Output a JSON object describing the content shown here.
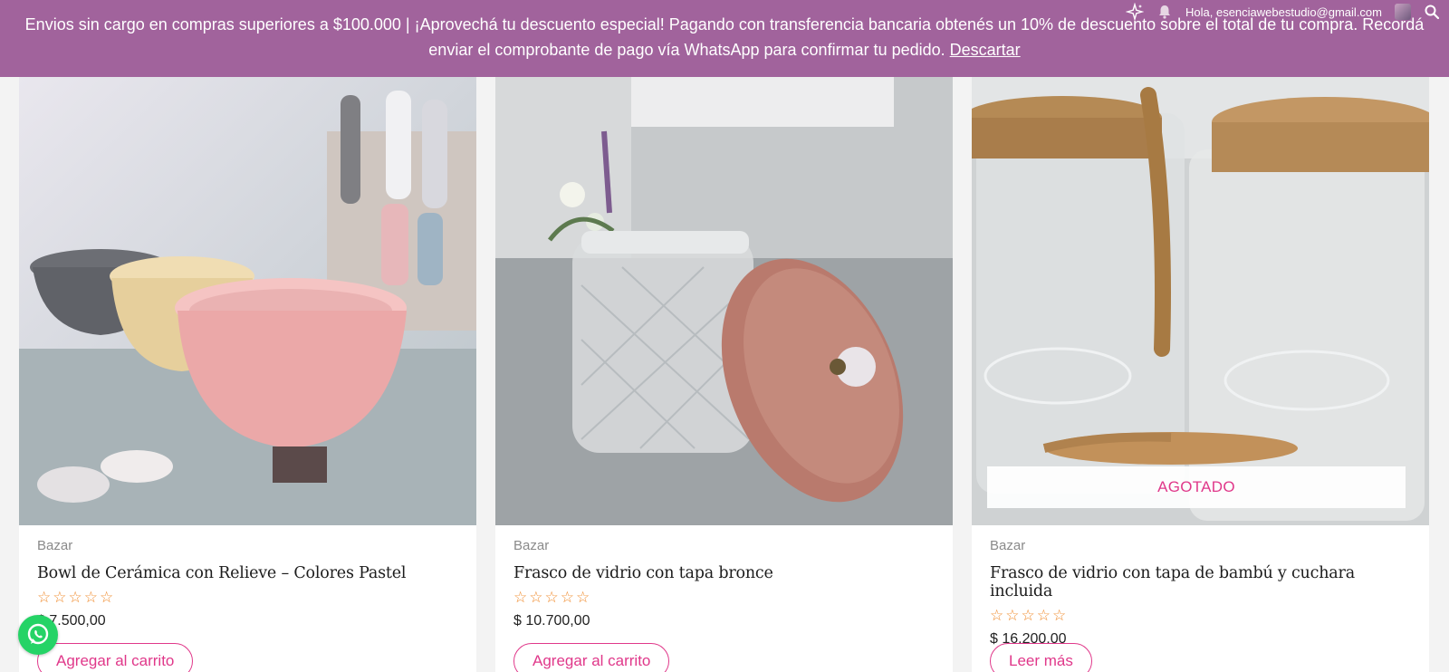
{
  "notice": {
    "text": "Envios sin cargo en compras superiores a $100.000 | ¡Aprovechá tu descuento especial! Pagando con transferencia bancaria obtenés un 10% de descuento sobre el total de tu compra. Recordá enviar el comprobante de pago vía WhatsApp para confirmar tu pedido.",
    "dismiss": "Descartar"
  },
  "admin": {
    "greeting": "Hola, esenciawebestudio@gmail.com",
    "icons": [
      "sparkle-icon",
      "bell-icon",
      "avatar",
      "search-icon"
    ]
  },
  "products": [
    {
      "category": "Bazar",
      "title": "Bowl de Cerámica con Relieve – Colores Pastel",
      "price": "$ 7.500,00",
      "rating": 0,
      "button": "Agregar al carrito",
      "badge": ""
    },
    {
      "category": "Bazar",
      "title": "Frasco de vidrio con tapa bronce",
      "price": "$ 10.700,00",
      "rating": 0,
      "button": "Agregar al carrito",
      "badge": ""
    },
    {
      "category": "Bazar",
      "title": "Frasco de vidrio con tapa de bambú y cuchara incluida",
      "price": "$ 16.200,00",
      "rating": 0,
      "button": "Leer más",
      "badge": "AGOTADO"
    }
  ],
  "colors": {
    "notice_bg": "#a1639c",
    "accent": "#e0388a",
    "star": "#f08a2b",
    "whatsapp": "#25d366"
  }
}
